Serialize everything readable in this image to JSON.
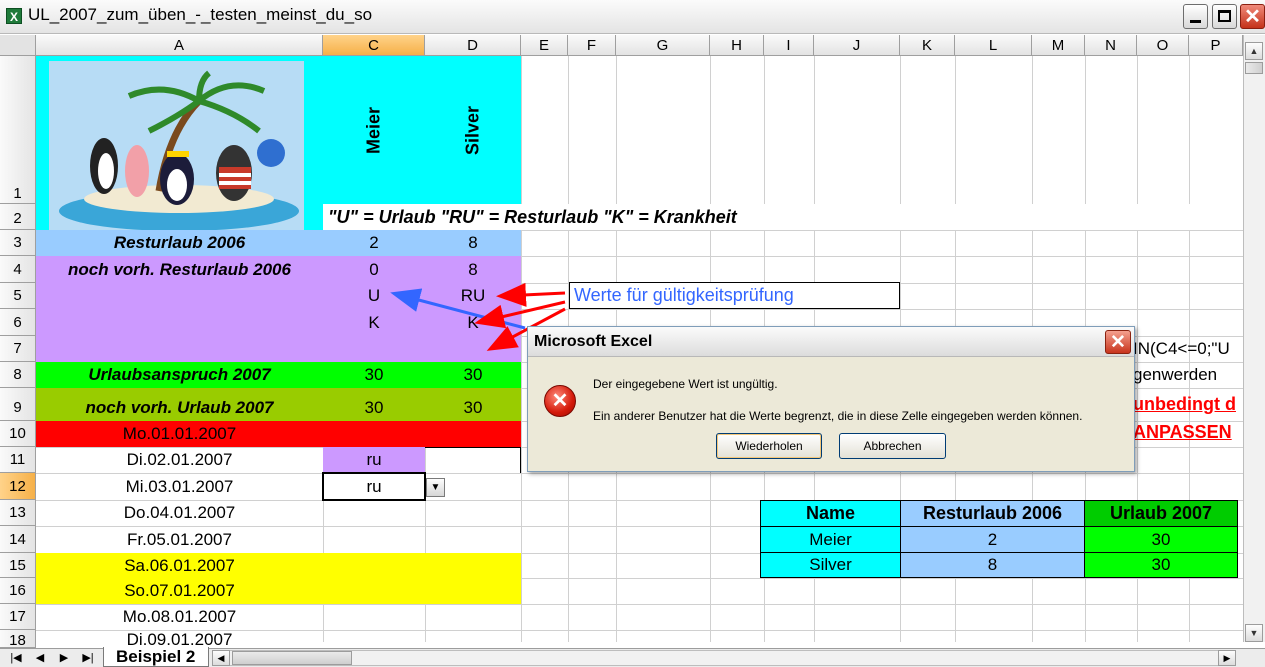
{
  "window": {
    "title": "UL_2007_zum_üben_-_testen_meinst_du_so"
  },
  "columns": [
    "A",
    "C",
    "D",
    "E",
    "F",
    "G",
    "H",
    "I",
    "J",
    "K",
    "L",
    "M",
    "N",
    "O",
    "P"
  ],
  "rows": [
    "1",
    "2",
    "3",
    "4",
    "5",
    "6",
    "7",
    "8",
    "9",
    "10",
    "11",
    "12",
    "13",
    "14",
    "15",
    "16",
    "17",
    "18"
  ],
  "header": {
    "name1": "Meier",
    "name2": "Silver"
  },
  "legend": "\"U\" = Urlaub  \"RU\" = Resturlaub  \"K\" = Krankheit",
  "sheet": {
    "r3": {
      "label": "Resturlaub 2006",
      "c": "2",
      "d": "8"
    },
    "r4": {
      "label": "noch vorh. Resturlaub 2006",
      "c": "0",
      "d": "8"
    },
    "r5": {
      "c": "U",
      "d": "RU"
    },
    "r6": {
      "c": "K",
      "d": "K"
    },
    "r8": {
      "label": "Urlaubsanspruch 2007",
      "c": "30",
      "d": "30"
    },
    "r9": {
      "label": "noch vorh. Urlaub 2007",
      "c": "30",
      "d": "30"
    },
    "dates": [
      "Mo.01.01.2007",
      "Di.02.01.2007",
      "Mi.03.01.2007",
      "Do.04.01.2007",
      "Fr.05.01.2007",
      "Sa.06.01.2007",
      "So.07.01.2007",
      "Mo.08.01.2007",
      "Di.09.01.2007"
    ],
    "c11": "ru",
    "c12": "ru",
    "note_box": "Werte für gültigkeitsprüfung",
    "formula_fragment": "IN(C4<=0;\"U",
    "text_fragment_8": "genwerden",
    "red_fragment_9": "unbedingt d",
    "red_fragment_10": "ANPASSEN"
  },
  "summary_table": {
    "headers": [
      "Name",
      "Resturlaub 2006",
      "Urlaub 2007"
    ],
    "rows": [
      [
        "Meier",
        "2",
        "30"
      ],
      [
        "Silver",
        "8",
        "30"
      ]
    ]
  },
  "dialog": {
    "title": "Microsoft Excel",
    "line1": "Der eingegebene Wert ist ungültig.",
    "line2": "Ein anderer Benutzer hat die Werte begrenzt, die in diese Zelle eingegeben werden können.",
    "retry_button": "Wiederholen",
    "cancel_button": "Abbrechen"
  },
  "tabs": {
    "active": "Beispiel 2"
  },
  "colors": {
    "cyan": "#00ffff",
    "lightblue": "#99ccff",
    "lavender": "#cc99ff",
    "green": "#00ff00",
    "olive": "#99cc00",
    "red": "#ff0000",
    "yellow": "#ffff00",
    "arrow_blue": "#3366ff",
    "arrow_red": "#ff0000"
  }
}
